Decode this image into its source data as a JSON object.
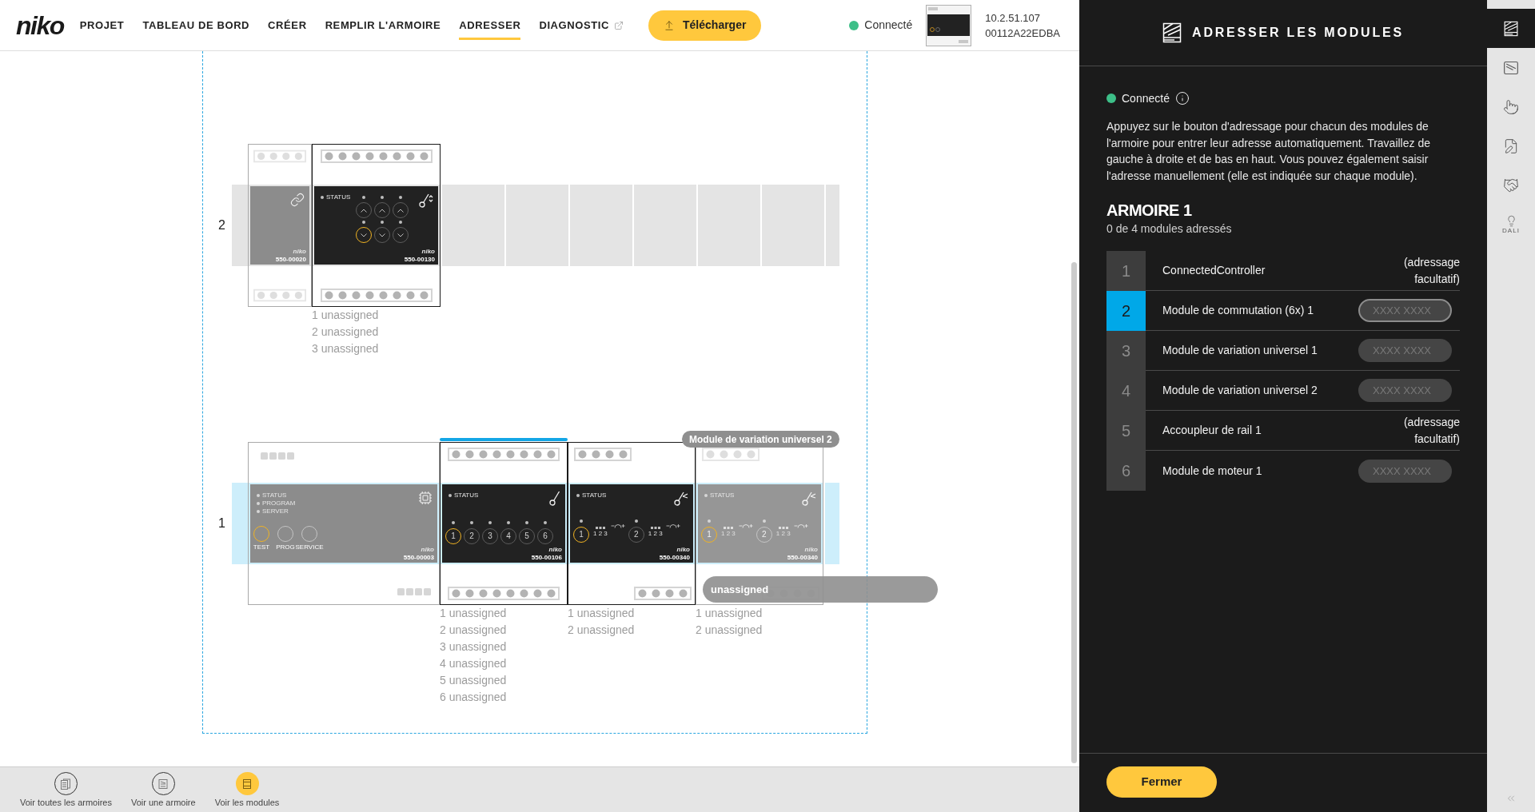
{
  "nav": {
    "logo": "niko",
    "items": [
      {
        "label": "PROJET",
        "selected": false,
        "external": false
      },
      {
        "label": "TABLEAU DE BORD",
        "selected": false,
        "external": false
      },
      {
        "label": "CRÉER",
        "selected": false,
        "external": false
      },
      {
        "label": "REMPLIR L'ARMOIRE",
        "selected": false,
        "external": false
      },
      {
        "label": "ADRESSER",
        "selected": true,
        "external": false
      },
      {
        "label": "DIAGNOSTIC",
        "selected": false,
        "external": true
      }
    ],
    "download_button": "Télécharger",
    "connection": {
      "label": "Connecté",
      "connected": true
    },
    "device": {
      "ip": "10.2.51.107",
      "mac": "00112A22EDBA"
    }
  },
  "canvas": {
    "cabinets": [
      {
        "label": "2",
        "highlighted": false,
        "modules": [
          {
            "kind": "coupler",
            "optional": true,
            "dimmed": false,
            "selected": false,
            "brand": "niko",
            "code": "550-00020"
          },
          {
            "kind": "motor",
            "optional": false,
            "dimmed": false,
            "selected": false,
            "brand": "niko",
            "code": "550-00130",
            "indicators": [
              "STATUS"
            ],
            "buttons": [
              {
                "kind": "up",
                "highlighted": false
              },
              {
                "kind": "up",
                "highlighted": false
              },
              {
                "kind": "up",
                "highlighted": false
              },
              {
                "kind": "down",
                "highlighted": true
              },
              {
                "kind": "down",
                "highlighted": false
              },
              {
                "kind": "down",
                "highlighted": false
              }
            ],
            "unassigned": [
              "1 unassigned",
              "2 unassigned",
              "3 unassigned"
            ]
          }
        ]
      },
      {
        "label": "1",
        "highlighted": true,
        "modules": [
          {
            "kind": "controller",
            "optional": true,
            "dimmed": false,
            "selected": false,
            "brand": "niko",
            "code": "550-00003",
            "indicators": [
              "STATUS",
              "PROGRAM",
              "SERVER"
            ],
            "buttons": [
              {
                "label": "TEST",
                "highlighted": true
              },
              {
                "label": "PROG",
                "highlighted": false
              },
              {
                "label": "SERVICE",
                "highlighted": false
              }
            ]
          },
          {
            "kind": "switch",
            "optional": false,
            "dimmed": false,
            "selected": true,
            "brand": "niko",
            "code": "550-00106",
            "indicators": [
              "STATUS"
            ],
            "buttons": [
              {
                "label": "1",
                "highlighted": true
              },
              {
                "label": "2",
                "highlighted": false
              },
              {
                "label": "3",
                "highlighted": false
              },
              {
                "label": "4",
                "highlighted": false
              },
              {
                "label": "5",
                "highlighted": false
              },
              {
                "label": "6",
                "highlighted": false
              }
            ],
            "unassigned": [
              "1 unassigned",
              "2 unassigned",
              "3 unassigned",
              "4 unassigned",
              "5 unassigned",
              "6 unassigned"
            ]
          },
          {
            "kind": "dimmer",
            "optional": false,
            "dimmed": false,
            "selected": false,
            "brand": "niko",
            "code": "550-00340",
            "indicators": [
              "STATUS"
            ],
            "channels": [
              {
                "label": "1",
                "scale": "1 2 3",
                "highlighted": true
              },
              {
                "label": "2",
                "scale": "1 2 3",
                "highlighted": false
              }
            ],
            "unassigned": [
              "1 unassigned",
              "2 unassigned"
            ]
          },
          {
            "kind": "dimmer",
            "optional": false,
            "dimmed": true,
            "selected": false,
            "brand": "niko",
            "code": "550-00340",
            "indicators": [
              "STATUS"
            ],
            "channels": [
              {
                "label": "1",
                "scale": "1 2 3",
                "highlighted": true
              },
              {
                "label": "2",
                "scale": "1 2 3",
                "highlighted": false
              }
            ],
            "unassigned": [
              "1 unassigned",
              "2 unassigned"
            ],
            "tooltip": "Module de variation universel 2",
            "drag_label": "unassigned"
          }
        ]
      }
    ]
  },
  "view_bar": {
    "buttons": [
      {
        "kind": "cabinets",
        "label": "Voir toutes les armoires",
        "selected": false
      },
      {
        "kind": "cabinet",
        "label": "Voir une armoire",
        "selected": false
      },
      {
        "kind": "modules",
        "label": "Voir les modules",
        "selected": true
      }
    ]
  },
  "panel": {
    "title": "ADRESSER LES MODULES",
    "status": {
      "label": "Connecté",
      "connected": true
    },
    "instructions": "Appuyez sur le bouton d'adressage pour chacun des modules de l'armoire pour entrer leur adresse automatiquement. Travaillez de gauche à droite et de bas en haut. Vous pouvez également saisir l'adresse manuellement (elle est indiquée sur chaque module).",
    "cabinet": {
      "title": "ARMOIRE 1",
      "progress": "0 de 4 modules adressés"
    },
    "rows": [
      {
        "number": "1",
        "name": "ConnectedController",
        "kind": "optional",
        "note": "(adressage facultatif)",
        "selected": false
      },
      {
        "number": "2",
        "name": "Module de commutation (6x) 1",
        "kind": "address",
        "placeholder": "XXXX XXXX",
        "selected": true
      },
      {
        "number": "3",
        "name": "Module de variation universel 1",
        "kind": "address",
        "placeholder": "XXXX XXXX",
        "selected": false
      },
      {
        "number": "4",
        "name": "Module de variation universel 2",
        "kind": "address",
        "placeholder": "XXXX XXXX",
        "selected": false
      },
      {
        "number": "5",
        "name": "Accoupleur de rail 1",
        "kind": "optional",
        "note": "(adressage facultatif)",
        "selected": false
      },
      {
        "number": "6",
        "name": "Module de moteur 1",
        "kind": "address",
        "placeholder": "XXXX XXXX",
        "selected": false
      }
    ],
    "close_button": "Fermer"
  },
  "side_tabs": [
    {
      "kind": "address",
      "selected": true
    },
    {
      "kind": "cabinet",
      "selected": false
    },
    {
      "kind": "touch",
      "selected": false
    },
    {
      "kind": "edit",
      "selected": false
    },
    {
      "kind": "handshake",
      "selected": false
    },
    {
      "kind": "dali",
      "label": "DALI",
      "selected": false
    }
  ]
}
